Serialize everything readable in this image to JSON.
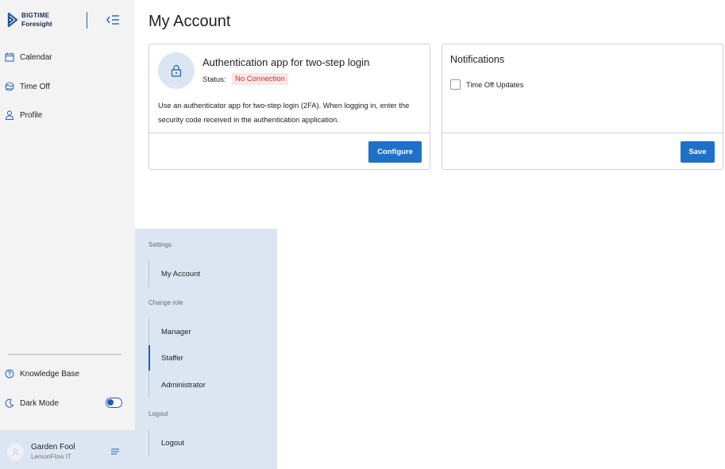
{
  "brand": {
    "line1": "BIGTIME",
    "line2": "Foresight"
  },
  "sidebar": {
    "items": [
      {
        "label": "Calendar",
        "icon": "calendar-icon"
      },
      {
        "label": "Time Off",
        "icon": "time-off-icon"
      },
      {
        "label": "Profile",
        "icon": "user-icon"
      }
    ],
    "knowledge_base": "Knowledge Base",
    "dark_mode": "Dark Mode",
    "dark_mode_on": true
  },
  "user": {
    "name": "Garden Fool",
    "org": "LemonFlow IT"
  },
  "page": {
    "title": "My Account"
  },
  "auth_card": {
    "title": "Authentication app for two-step login",
    "status_label": "Status:",
    "status_value": "No Connection",
    "description": "Use an authenticator app for two-step login (2FA). When logging in, enter the security code received in the authentication application.",
    "button": "Configure"
  },
  "notifications_card": {
    "title": "Notifications",
    "checkbox_label": "Time Off Updates",
    "checked": false,
    "button": "Save"
  },
  "menu": {
    "settings_header": "Settings",
    "my_account": "My Account",
    "change_role_header": "Change role",
    "roles": [
      "Manager",
      "Staffer",
      "Administrator"
    ],
    "active_role": "Staffer",
    "logout_header": "Logout",
    "logout": "Logout"
  },
  "colors": {
    "accent": "#1e70c8",
    "danger": "#d32f2f",
    "panel": "#dce6f3"
  }
}
